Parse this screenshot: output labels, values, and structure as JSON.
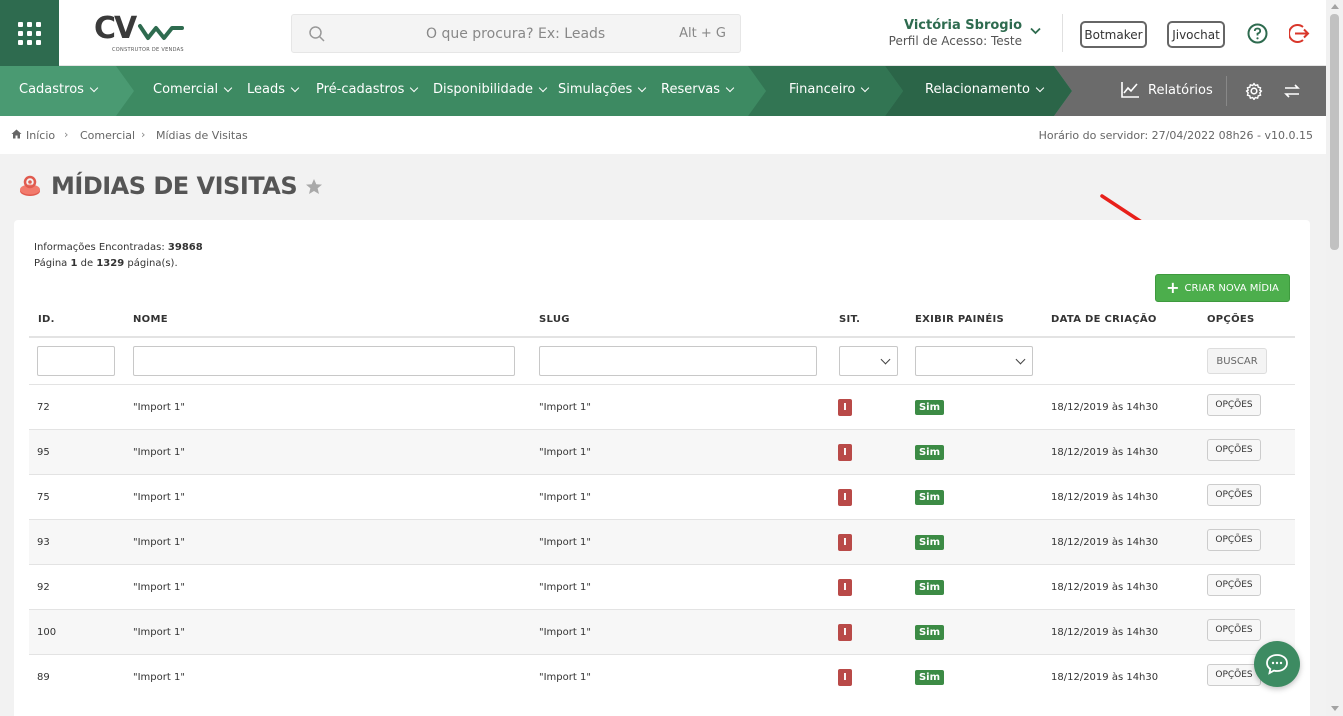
{
  "header": {
    "logo_text": "CV",
    "logo_sub": "CONSTRUTOR DE VENDAS",
    "search_placeholder": "O que procura? Ex: Leads",
    "search_shortcut": "Alt + G",
    "user_name": "Victória Sbrogio",
    "user_profile": "Perfil de Acesso: Teste",
    "botmaker_label": "Botmaker",
    "jivochat_label": "Jivochat"
  },
  "menu": {
    "cadastros": "Cadastros",
    "comercial": "Comercial",
    "leads": "Leads",
    "pre_cadastros": "Pré-cadastros",
    "disponibilidade": "Disponibilidade",
    "simulacoes": "Simulações",
    "reservas": "Reservas",
    "financeiro": "Financeiro",
    "relacionamento": "Relacionamento",
    "relatorios": "Relatórios"
  },
  "breadcrumb": {
    "home": "Início",
    "comercial": "Comercial",
    "current": "Mídias de Visitas",
    "server_time": "Horário do servidor: 27/04/2022 08h26 - v10.0.15"
  },
  "page": {
    "title": "MÍDIAS DE VISITAS",
    "info_found_label": "Informações Encontradas:",
    "info_found_value": "39868",
    "page_label": "Página",
    "page_current": "1",
    "page_of": "de",
    "page_total": "1329",
    "page_suffix": "página(s).",
    "new_button": "CRIAR NOVA MÍDIA",
    "search_button": "BUSCAR"
  },
  "table": {
    "headers": {
      "id": "ID.",
      "nome": "NOME",
      "slug": "SLUG",
      "sit": "SIT.",
      "exibir": "EXIBIR PAINÉIS",
      "data": "DATA DE CRIAÇÃO",
      "opcoes": "OPÇÕES"
    },
    "rows": [
      {
        "id": "72",
        "nome": "\"Import 1\"",
        "slug": "\"Import 1\"",
        "sit": "I",
        "exibir": "Sim",
        "data": "18/12/2019 às 14h30",
        "opt": "OPÇÕES"
      },
      {
        "id": "95",
        "nome": "\"Import 1\"",
        "slug": "\"Import 1\"",
        "sit": "I",
        "exibir": "Sim",
        "data": "18/12/2019 às 14h30",
        "opt": "OPÇÕES"
      },
      {
        "id": "75",
        "nome": "\"Import 1\"",
        "slug": "\"Import 1\"",
        "sit": "I",
        "exibir": "Sim",
        "data": "18/12/2019 às 14h30",
        "opt": "OPÇÕES"
      },
      {
        "id": "93",
        "nome": "\"Import 1\"",
        "slug": "\"Import 1\"",
        "sit": "I",
        "exibir": "Sim",
        "data": "18/12/2019 às 14h30",
        "opt": "OPÇÕES"
      },
      {
        "id": "92",
        "nome": "\"Import 1\"",
        "slug": "\"Import 1\"",
        "sit": "I",
        "exibir": "Sim",
        "data": "18/12/2019 às 14h30",
        "opt": "OPÇÕES"
      },
      {
        "id": "100",
        "nome": "\"Import 1\"",
        "slug": "\"Import 1\"",
        "sit": "I",
        "exibir": "Sim",
        "data": "18/12/2019 às 14h30",
        "opt": "OPÇÕES"
      },
      {
        "id": "89",
        "nome": "\"Import 1\"",
        "slug": "\"Import 1\"",
        "sit": "I",
        "exibir": "Sim",
        "data": "18/12/2019 às 14h30",
        "opt": "OPÇÕES"
      }
    ]
  },
  "colors": {
    "brand_dark": "#2e6b4f",
    "menu_green": "#4a9a72",
    "accent_button": "#4cae4c",
    "badge_inactive": "#b94a48",
    "badge_yes": "#3c8b45"
  },
  "icons": [
    "apps-grid-icon",
    "search-icon",
    "chevron-down-icon",
    "help-icon",
    "exit-icon",
    "home-icon",
    "star-icon",
    "chart-icon",
    "gear-icon",
    "swap-icon",
    "chat-icon"
  ]
}
